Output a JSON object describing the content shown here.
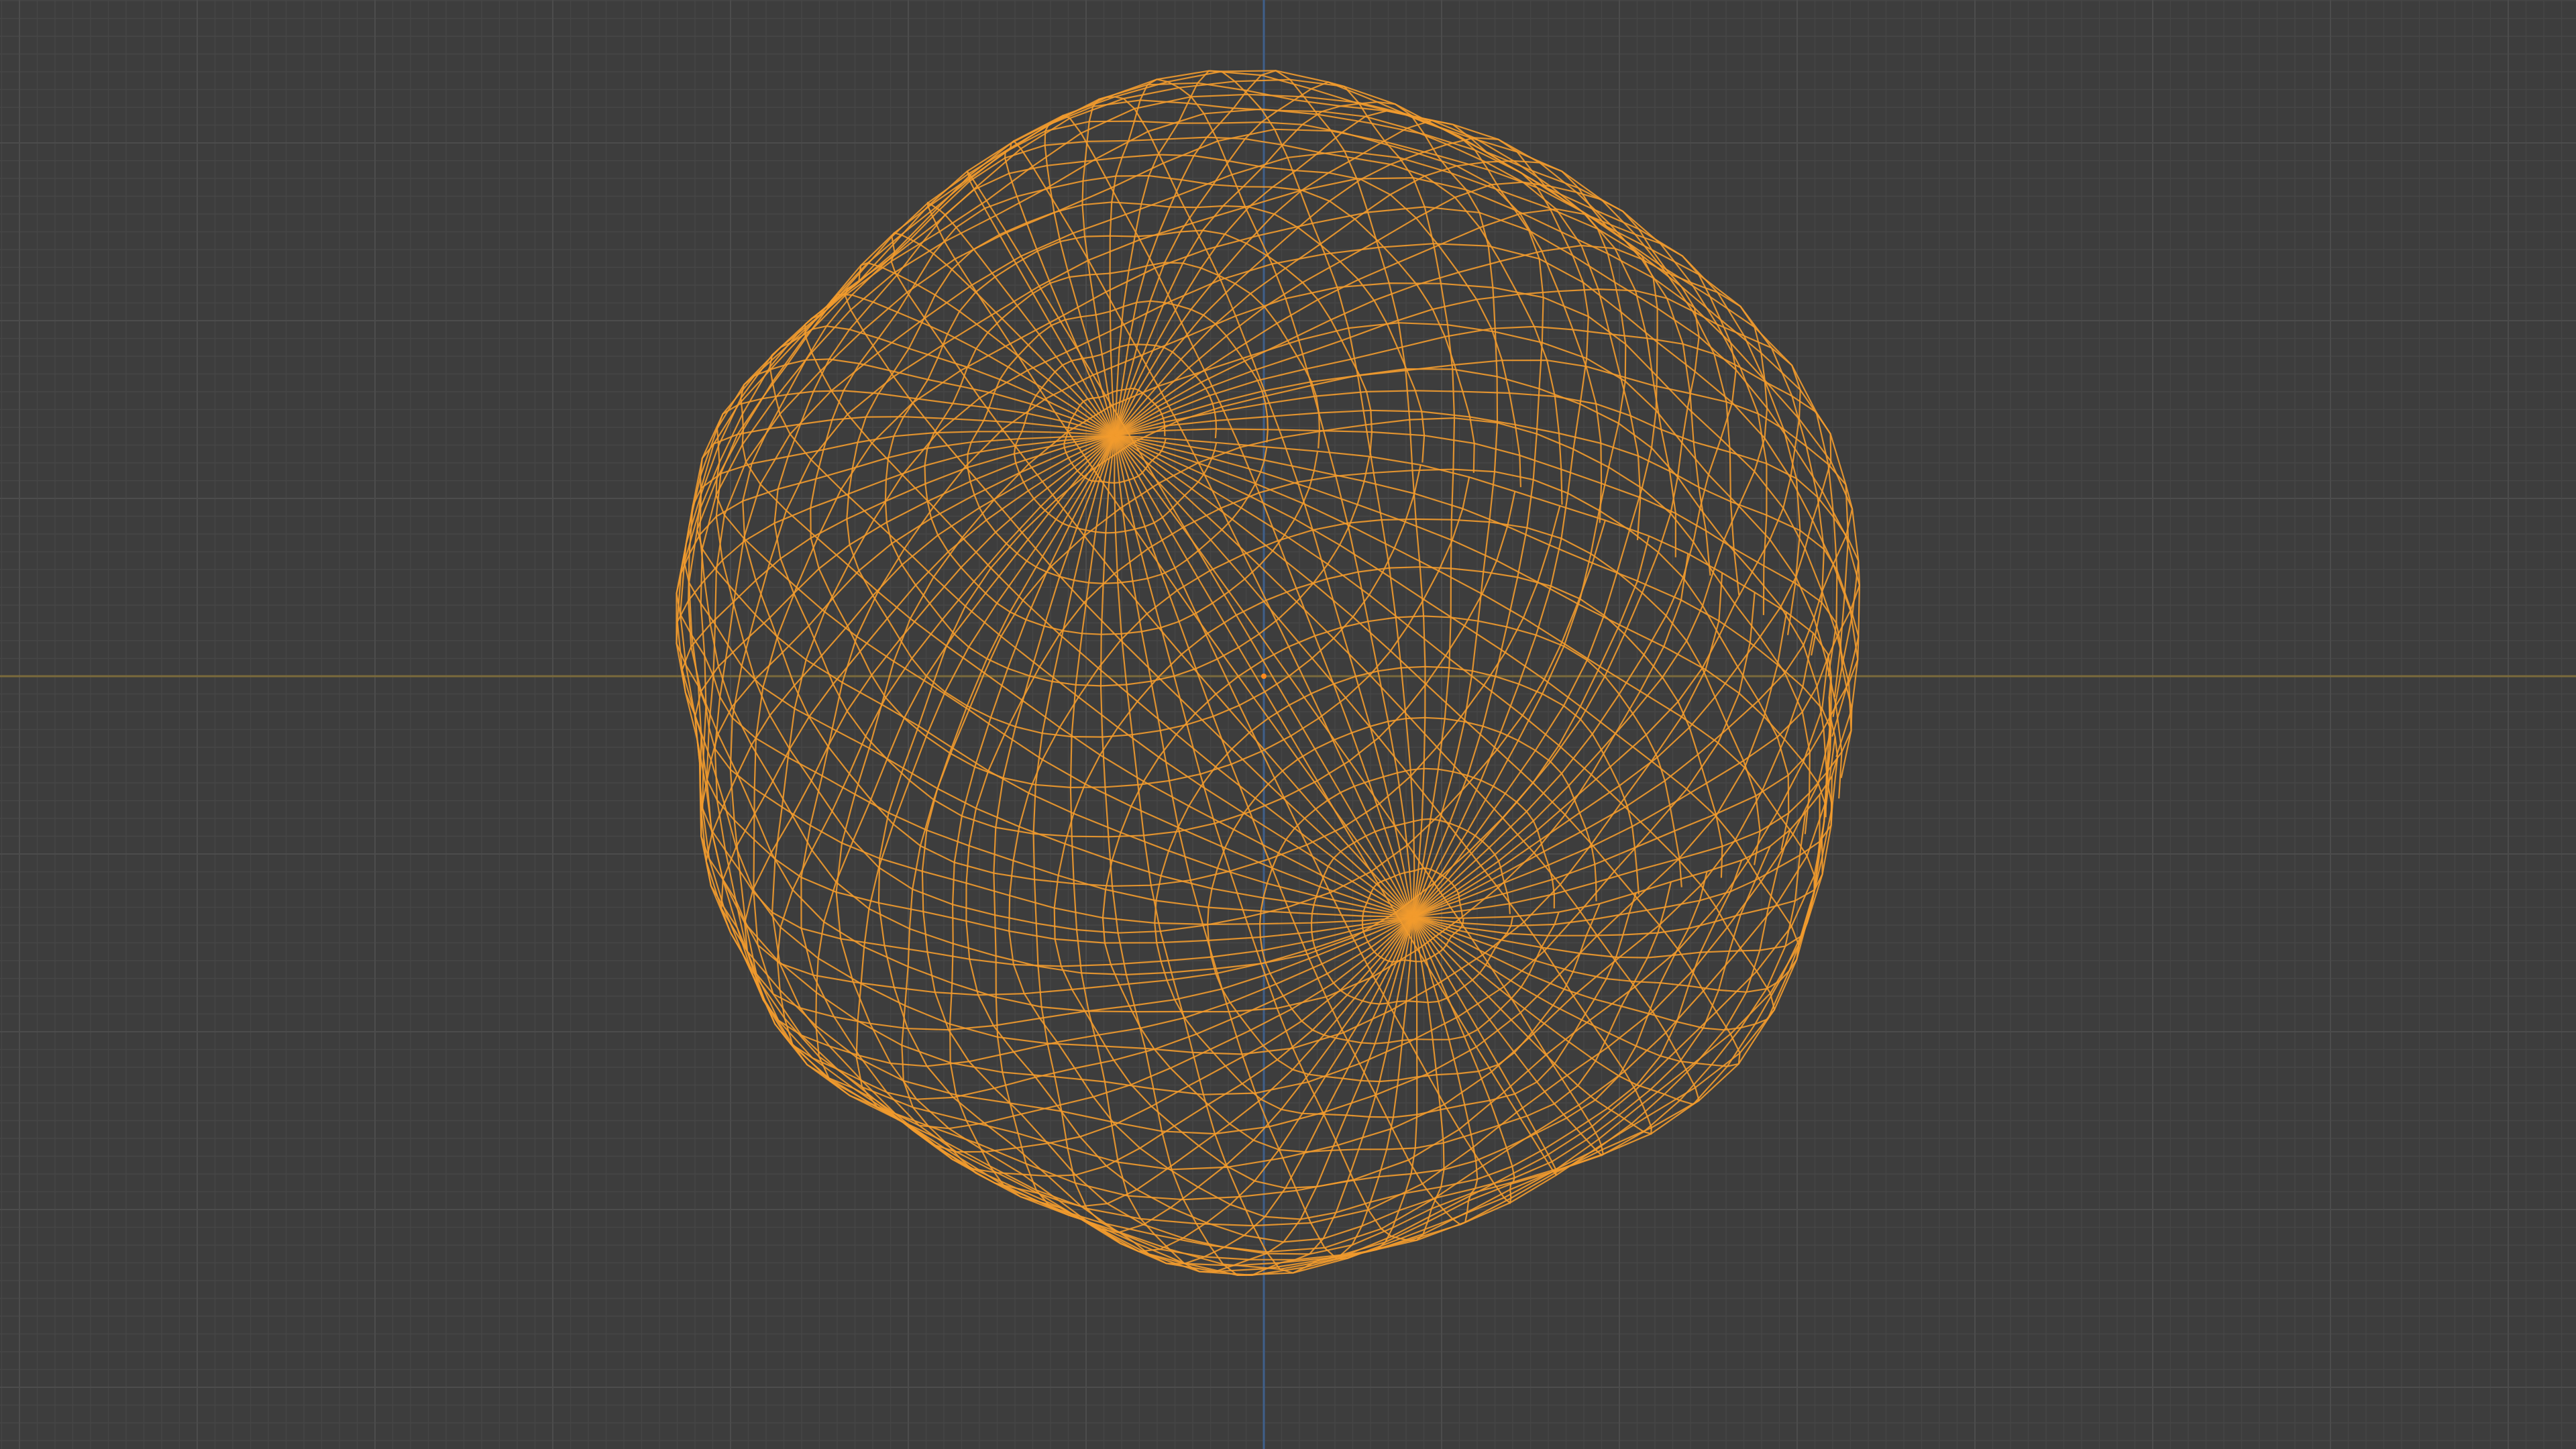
{
  "viewport": {
    "view": "top-orthographic",
    "shading": "wireframe",
    "background_color": "#3d3d3d",
    "grid": {
      "visible": true,
      "minor_color": "#464646",
      "major_color": "#4c4c4c"
    },
    "axes": {
      "x_axis_color": "#7a6a3c",
      "y_axis_color": "#3f5f8a"
    },
    "object": {
      "type": "sphere",
      "state": "selected",
      "wire_color": "#f29b2e",
      "origin_color": "#ff8a1e"
    }
  }
}
